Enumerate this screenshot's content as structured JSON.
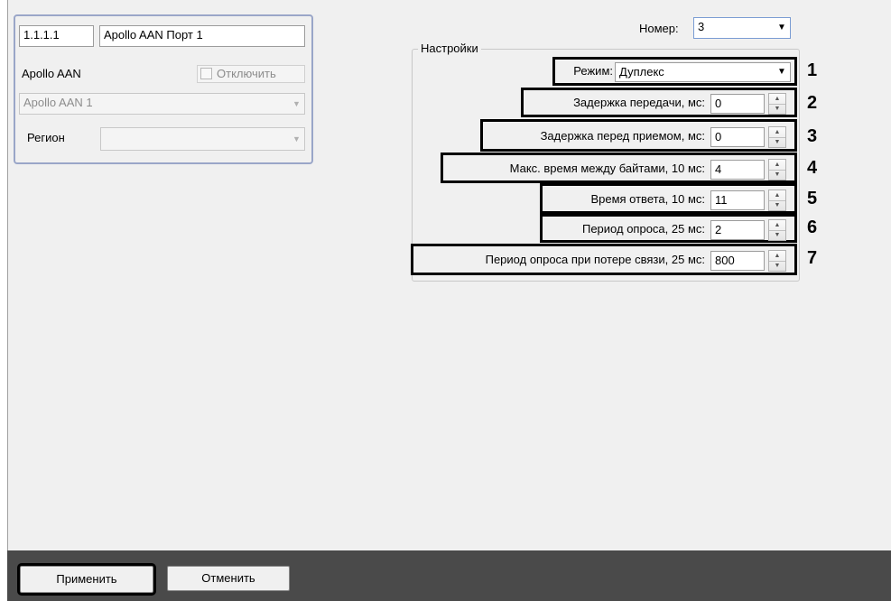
{
  "object_panel": {
    "id_value": "1.1.1.1",
    "name_value": "Apollo AAN Порт 1",
    "parent_label": "Apollo AAN",
    "disable_checkbox_label": "Отключить",
    "device_select_value": "Apollo AAN 1",
    "region_label": "Регион",
    "region_value": ""
  },
  "number": {
    "label": "Номер:",
    "value": "3"
  },
  "settings": {
    "group_title": "Настройки",
    "mode": {
      "label": "Режим:",
      "value": "Дуплекс",
      "marker": "1"
    },
    "rows": [
      {
        "label": "Задержка передачи, мс:",
        "value": "0",
        "marker": "2"
      },
      {
        "label": "Задержка перед приемом, мс:",
        "value": "0",
        "marker": "3"
      },
      {
        "label": "Макс. время между байтами, 10 мс:",
        "value": "4",
        "marker": "4"
      },
      {
        "label": "Время ответа, 10 мс:",
        "value": "11",
        "marker": "5"
      },
      {
        "label": "Период опроса, 25 мс:",
        "value": "2",
        "marker": "6"
      },
      {
        "label": "Период опроса при потере связи, 25 мс:",
        "value": "800",
        "marker": "7"
      }
    ]
  },
  "footer": {
    "apply_label": "Применить",
    "cancel_label": "Отменить"
  },
  "icons": {
    "dropdown": "triangle-down",
    "spin_up": "triangle-up",
    "spin_down": "triangle-down"
  }
}
